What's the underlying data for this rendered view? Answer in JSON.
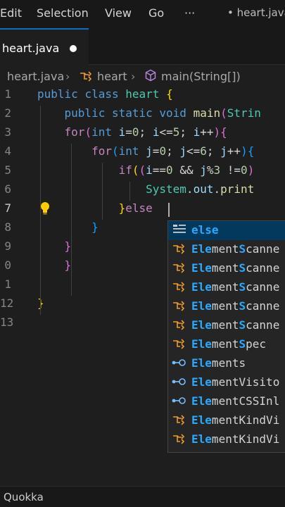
{
  "menu": {
    "items": [
      "Edit",
      "Selection",
      "View",
      "Go"
    ],
    "more": "···",
    "dirty_file": "• heart.java"
  },
  "tab": {
    "label": "heart.java",
    "dirty": true
  },
  "breadcrumb": {
    "file": "heart.java",
    "class": "heart",
    "method": "main(String[])"
  },
  "editor": {
    "line_numbers": [
      "1",
      "2",
      "3",
      "4",
      "5",
      "6",
      "7",
      "8",
      "9",
      "0",
      "1",
      "12",
      "13"
    ],
    "active_line": "7",
    "lines": [
      {
        "tokens": [
          {
            "t": "public",
            "c": "kw"
          },
          {
            "t": " ",
            "c": "op"
          },
          {
            "t": "class",
            "c": "kw"
          },
          {
            "t": " ",
            "c": "op"
          },
          {
            "t": "heart",
            "c": "ty"
          },
          {
            "t": " ",
            "c": "op"
          },
          {
            "t": "{",
            "c": "br1"
          }
        ]
      },
      {
        "tokens": [
          {
            "t": "    ",
            "c": "op"
          },
          {
            "t": "public",
            "c": "kw"
          },
          {
            "t": " ",
            "c": "op"
          },
          {
            "t": "static",
            "c": "kw"
          },
          {
            "t": " ",
            "c": "op"
          },
          {
            "t": "void",
            "c": "kw"
          },
          {
            "t": " ",
            "c": "op"
          },
          {
            "t": "main",
            "c": "fn"
          },
          {
            "t": "(",
            "c": "br2"
          },
          {
            "t": "Strin",
            "c": "ty"
          }
        ]
      },
      {
        "tokens": [
          {
            "t": "    ",
            "c": "op"
          },
          {
            "t": "for",
            "c": "ctl"
          },
          {
            "t": "(",
            "c": "br2"
          },
          {
            "t": "int",
            "c": "kw"
          },
          {
            "t": " ",
            "c": "op"
          },
          {
            "t": "i",
            "c": "var"
          },
          {
            "t": "=",
            "c": "op"
          },
          {
            "t": "0",
            "c": "num"
          },
          {
            "t": "; ",
            "c": "op"
          },
          {
            "t": "i",
            "c": "var"
          },
          {
            "t": "<=",
            "c": "op"
          },
          {
            "t": "5",
            "c": "num"
          },
          {
            "t": "; ",
            "c": "op"
          },
          {
            "t": "i",
            "c": "var"
          },
          {
            "t": "++",
            "c": "op"
          },
          {
            "t": ")",
            "c": "br2"
          },
          {
            "t": "{",
            "c": "br2"
          }
        ]
      },
      {
        "tokens": [
          {
            "t": "        ",
            "c": "op"
          },
          {
            "t": "for",
            "c": "ctl"
          },
          {
            "t": "(",
            "c": "br3"
          },
          {
            "t": "int",
            "c": "kw"
          },
          {
            "t": " ",
            "c": "op"
          },
          {
            "t": "j",
            "c": "var"
          },
          {
            "t": "=",
            "c": "op"
          },
          {
            "t": "0",
            "c": "num"
          },
          {
            "t": "; ",
            "c": "op"
          },
          {
            "t": "j",
            "c": "var"
          },
          {
            "t": "<=",
            "c": "op"
          },
          {
            "t": "6",
            "c": "num"
          },
          {
            "t": "; ",
            "c": "op"
          },
          {
            "t": "j",
            "c": "var"
          },
          {
            "t": "++",
            "c": "op"
          },
          {
            "t": ")",
            "c": "br3"
          },
          {
            "t": "{",
            "c": "br3"
          }
        ]
      },
      {
        "tokens": [
          {
            "t": "            ",
            "c": "op"
          },
          {
            "t": "if",
            "c": "ctl"
          },
          {
            "t": "(",
            "c": "br1"
          },
          {
            "t": "(",
            "c": "br2"
          },
          {
            "t": "i",
            "c": "var"
          },
          {
            "t": "==",
            "c": "op"
          },
          {
            "t": "0",
            "c": "num"
          },
          {
            "t": " && ",
            "c": "op"
          },
          {
            "t": "j",
            "c": "var"
          },
          {
            "t": "%",
            "c": "op"
          },
          {
            "t": "3",
            "c": "num"
          },
          {
            "t": " !=",
            "c": "op"
          },
          {
            "t": "0",
            "c": "num"
          },
          {
            "t": ")",
            "c": "br2"
          }
        ]
      },
      {
        "tokens": [
          {
            "t": "                ",
            "c": "op"
          },
          {
            "t": "System",
            "c": "ty"
          },
          {
            "t": ".",
            "c": "op"
          },
          {
            "t": "out",
            "c": "var"
          },
          {
            "t": ".",
            "c": "op"
          },
          {
            "t": "print",
            "c": "fn"
          }
        ]
      },
      {
        "tokens": [
          {
            "t": "            ",
            "c": "op"
          },
          {
            "t": "}",
            "c": "br1"
          },
          {
            "t": "else",
            "c": "ctl"
          }
        ]
      },
      {
        "tokens": [
          {
            "t": "        ",
            "c": "op"
          },
          {
            "t": "}",
            "c": "br3"
          }
        ]
      },
      {
        "tokens": [
          {
            "t": "    ",
            "c": "op"
          },
          {
            "t": "}",
            "c": "br2"
          }
        ]
      },
      {
        "tokens": [
          {
            "t": "    ",
            "c": "op"
          },
          {
            "t": "}",
            "c": "br2"
          }
        ]
      },
      {
        "tokens": []
      },
      {
        "tokens": [
          {
            "t": "}",
            "c": "br1"
          }
        ]
      },
      {
        "tokens": []
      }
    ]
  },
  "suggestions": [
    {
      "kind": "kw",
      "icon": "snippet-keyword-icon",
      "prefix": "",
      "match": "",
      "rest": "",
      "label_full": "else",
      "match_only": true
    },
    {
      "kind": "class",
      "icon": "class-icon",
      "label_full": "ElementScanne",
      "bold_idx": [
        0,
        7
      ]
    },
    {
      "kind": "class",
      "icon": "class-icon",
      "label_full": "ElementScanne",
      "bold_idx": [
        0,
        7
      ]
    },
    {
      "kind": "class",
      "icon": "class-icon",
      "label_full": "ElementScanne",
      "bold_idx": [
        0,
        7
      ]
    },
    {
      "kind": "class",
      "icon": "class-icon",
      "label_full": "ElementScanne",
      "bold_idx": [
        0,
        7
      ]
    },
    {
      "kind": "class",
      "icon": "class-icon",
      "label_full": "ElementScanne",
      "bold_idx": [
        0,
        7
      ]
    },
    {
      "kind": "class",
      "icon": "class-icon",
      "label_full": "ElementSpec",
      "bold_idx": [
        0,
        7
      ]
    },
    {
      "kind": "field",
      "icon": "field-icon",
      "label_full": "Elements",
      "bold_idx": [
        0,
        4
      ]
    },
    {
      "kind": "field",
      "icon": "field-icon",
      "label_full": "ElementVisito",
      "bold_idx": [
        0,
        4
      ]
    },
    {
      "kind": "field",
      "icon": "field-icon",
      "label_full": "ElementCSSInl",
      "bold_idx": [
        0,
        4
      ]
    },
    {
      "kind": "class",
      "icon": "class-icon",
      "label_full": "ElementKindVi",
      "bold_idx": [
        0,
        4
      ]
    },
    {
      "kind": "class",
      "icon": "class-icon",
      "label_full": "ElementKindVi",
      "bold_idx": [
        0,
        4
      ]
    }
  ],
  "status": {
    "label": "Quokka"
  }
}
